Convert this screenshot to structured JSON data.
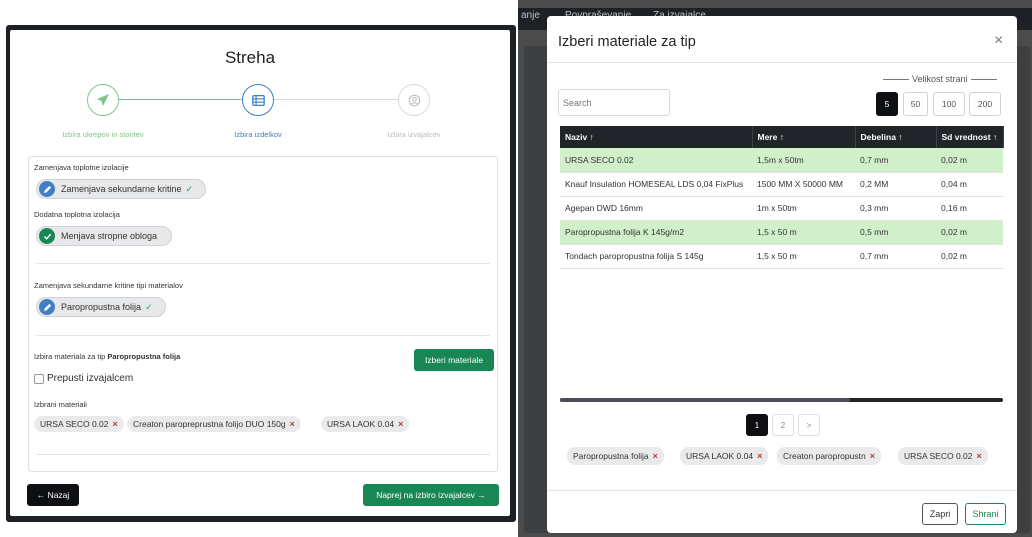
{
  "left": {
    "title": "Streha",
    "steps": [
      {
        "label": "Izbira ukrepov in storitev",
        "state": "done"
      },
      {
        "label": "Izbira izdelkov",
        "state": "active"
      },
      {
        "label": "Izbira izvajalcev",
        "state": "pending"
      }
    ],
    "section1_label": "Zamenjava toplotne izolacije",
    "pill1": "Zamenjava sekundarne kritine",
    "section2_label": "Dodatna toplotna izolacija",
    "pill2": "Menjava stropne obloga",
    "section3_label": "Zamenjava sekundarne kritine tipi materialov",
    "pill3": "Paropropustna folija",
    "material_prefix": "Izbira materiala za tip ",
    "material_type": "Paropropustna folija",
    "select_materials_button": "Izberi materiale",
    "leave_to_contractor": "Prepusti izvajalcem",
    "selected_label": "Izbrani materiali",
    "selected_chips": [
      "URSA SECO 0.02",
      "Creaton paropreprustna folijo DUO 150g",
      "URSA LAOK 0.04"
    ],
    "back_button": "← Nazaj",
    "next_button": "Naprej na izbiro izvajalcev →"
  },
  "nav": {
    "items": [
      "anje",
      "Povpraševanje",
      "Za izvajalce"
    ]
  },
  "modal": {
    "title": "Izberi materiale za tip",
    "close": "×",
    "search_placeholder": "Search",
    "page_size_label": "Velikost strani",
    "page_sizes": [
      "5",
      "50",
      "100",
      "200"
    ],
    "columns": [
      "Naziv ↑",
      "Mere ↑",
      "Debelina ↑",
      "Sd vrednost ↑"
    ],
    "rows": [
      {
        "naziv": "URSA SECO 0.02",
        "mere": "1,5m x 50tm",
        "debelina": "0,7 mm",
        "sd": "0,02 m",
        "selected": true
      },
      {
        "naziv": "Knauf Insulation HOMESEAL LDS 0,04 FixPlus",
        "mere": "1500 MM X 50000 MM",
        "debelina": "0,2 MM",
        "sd": "0,04 m",
        "selected": false
      },
      {
        "naziv": "Agepan DWD 16mm",
        "mere": "1m x 50tm",
        "debelina": "0,3 mm",
        "sd": "0,16 m",
        "selected": false
      },
      {
        "naziv": "Paropropustna folija K 145g/m2",
        "mere": "1,5 x 50 m",
        "debelina": "0,5 mm",
        "sd": "0,02 m",
        "selected": true
      },
      {
        "naziv": "Tondach paropropustna folija S 145g",
        "mere": "1,5 x 50 m",
        "debelina": "0,7 mm",
        "sd": "0,02 m",
        "selected": false
      }
    ],
    "pagination": [
      "1",
      "2",
      ">"
    ],
    "chips": [
      "Paropropustna folija",
      "URSA LAOK 0.04",
      "Creaton paropropustn",
      "URSA SECO 0.02"
    ],
    "close_button": "Zapri",
    "save_button": "Shrani"
  },
  "colors": {
    "green": "#198754",
    "step_done": "#7cc68b",
    "step_active": "#3f7fc4",
    "selected_row": "#d1f0c9"
  }
}
